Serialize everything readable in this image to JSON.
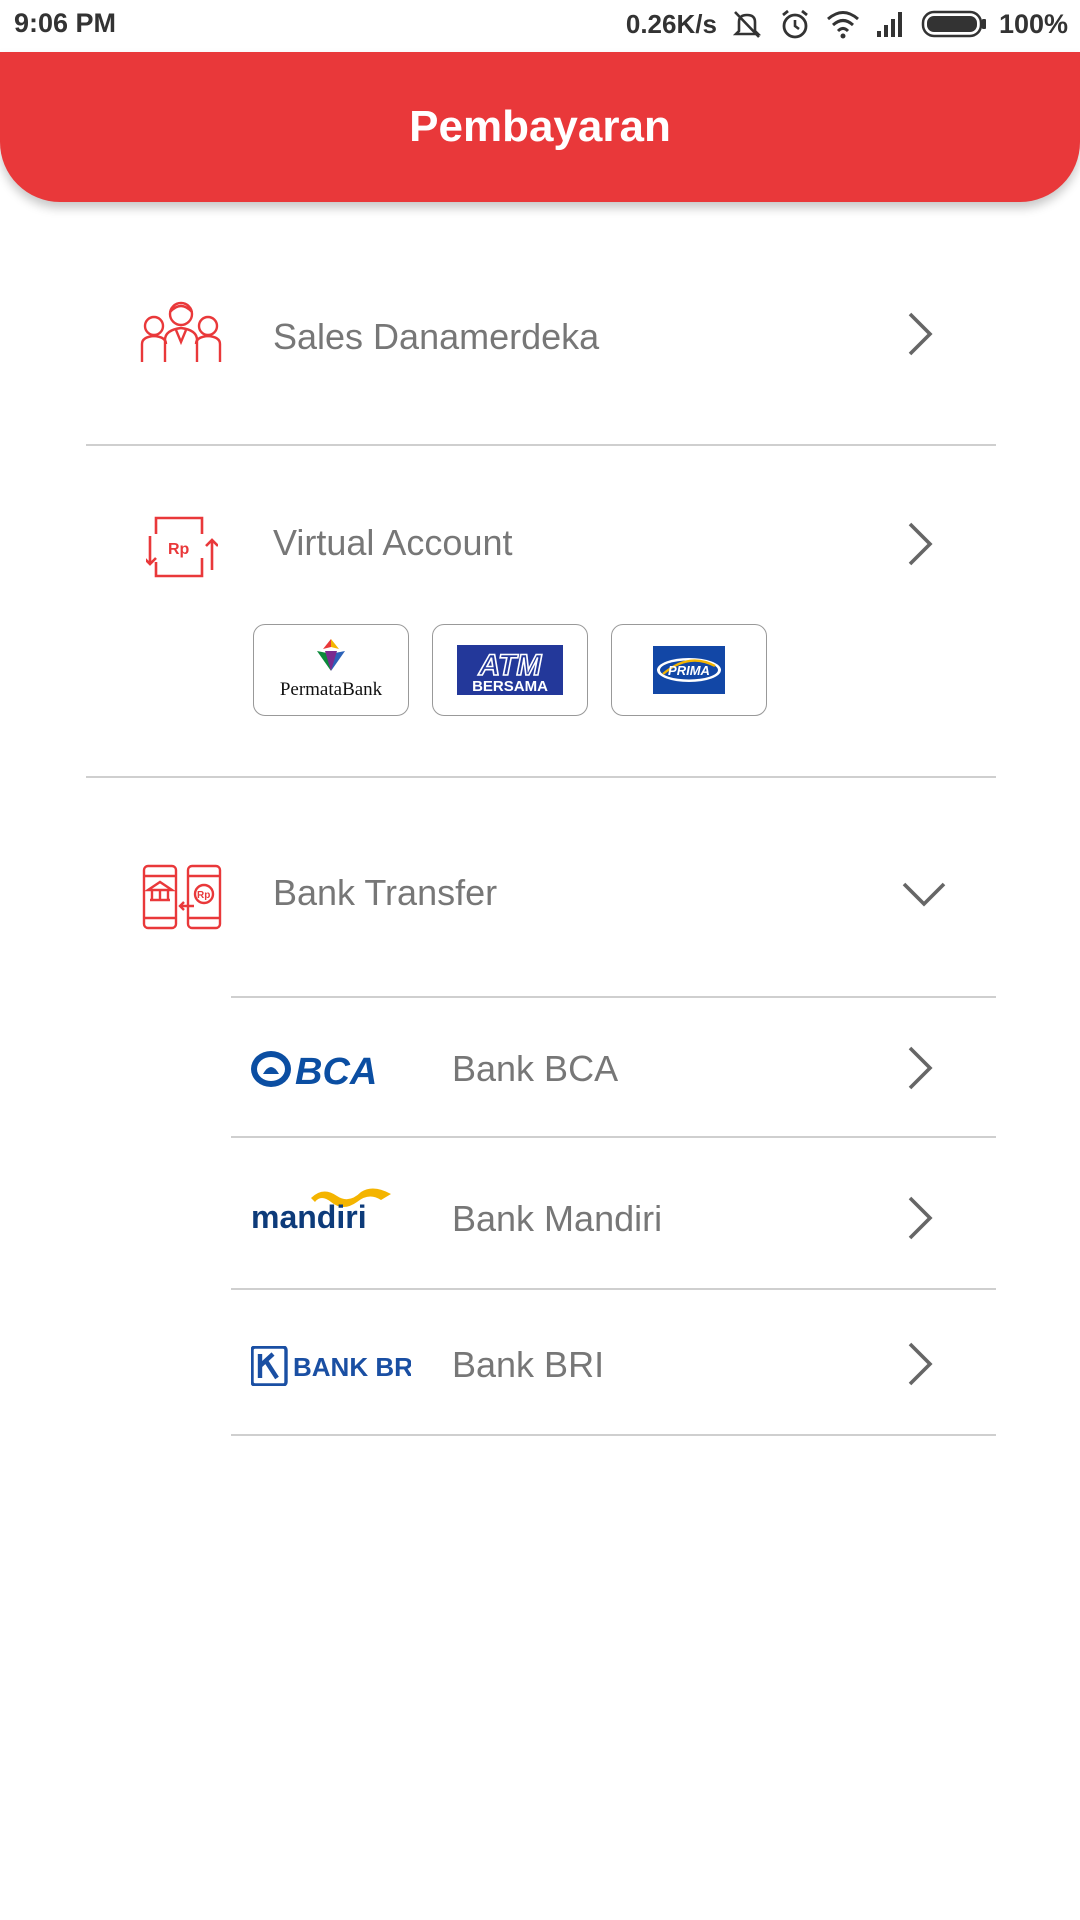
{
  "status_bar": {
    "time": "9:06 PM",
    "speed": "0.26K/s",
    "battery": "100%",
    "icons": [
      "mute-icon",
      "alarm-icon",
      "wifi-icon",
      "signal-icon",
      "battery-icon"
    ]
  },
  "header": {
    "title": "Pembayaran",
    "color": "#e9383a"
  },
  "menu": {
    "sales": {
      "label": "Sales Danamerdeka",
      "icon": "salespeople-icon"
    },
    "virtual_account": {
      "label": "Virtual Account",
      "icon": "rupiah-transfer-icon",
      "networks": [
        {
          "name": "PermataBank",
          "logo": "permatabank-logo"
        },
        {
          "name": "ATM BERSAMA",
          "logo_text_top": "ATM",
          "logo_text_bottom": "BERSAMA"
        },
        {
          "name": "PRIMA",
          "logo_text": "PRIMA"
        }
      ]
    },
    "bank_transfer": {
      "label": "Bank Transfer",
      "icon": "bank-transfer-icon",
      "expanded": true,
      "banks": [
        {
          "label": "Bank BCA",
          "logo_text": "BCA"
        },
        {
          "label": "Bank Mandiri",
          "logo_text": "mandiri"
        },
        {
          "label": "Bank BRI",
          "logo_text": "BANK BRI"
        }
      ]
    }
  }
}
